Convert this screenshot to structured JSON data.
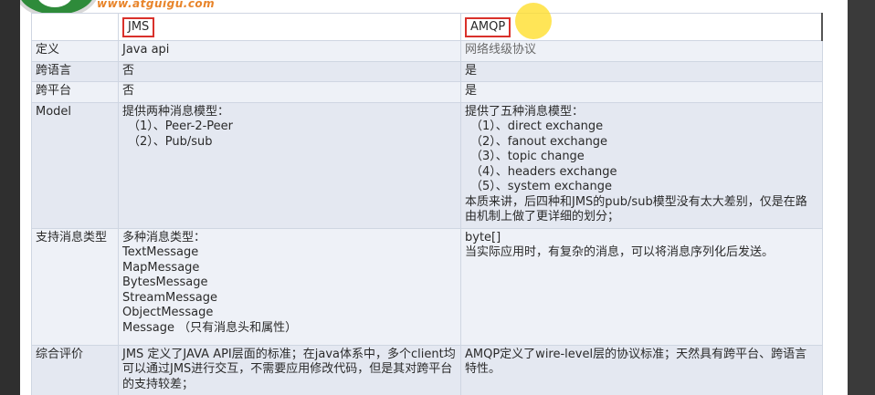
{
  "logo": {
    "text": "www.atguigu.com"
  },
  "table": {
    "header": {
      "left": "",
      "jms": "JMS",
      "amqp": "AMQP"
    },
    "rows": [
      {
        "label": "定义",
        "jms": [
          "Java api"
        ],
        "amqp": [
          "网络线级协议"
        ]
      },
      {
        "label": "跨语言",
        "jms": [
          "否"
        ],
        "amqp": [
          "是"
        ]
      },
      {
        "label": "跨平台",
        "jms": [
          "否"
        ],
        "amqp": [
          "是"
        ]
      },
      {
        "label": "Model",
        "jms": [
          "提供两种消息模型：",
          "（1）、Peer-2-Peer",
          "（2）、Pub/sub"
        ],
        "amqp": [
          "提供了五种消息模型：",
          "（1）、direct exchange",
          "（2）、fanout exchange",
          "（3）、topic change",
          "（4）、headers exchange",
          "（5）、system exchange",
          "本质来讲，后四种和JMS的pub/sub模型没有太大差别，仅是在路由机制上做了更详细的划分；"
        ]
      },
      {
        "label": "支持消息类型",
        "jms": [
          "多种消息类型：",
          "TextMessage",
          "MapMessage",
          "BytesMessage",
          "StreamMessage",
          "ObjectMessage",
          "Message （只有消息头和属性）"
        ],
        "amqp": [
          "byte[]",
          "当实际应用时，有复杂的消息，可以将消息序列化后发送。"
        ]
      },
      {
        "label": "综合评价",
        "jms": [
          "JMS 定义了JAVA API层面的标准；在java体系中，多个client均可以通过JMS进行交互，不需要应用修改代码，但是其对跨平台的支持较差；"
        ],
        "amqp": [
          "AMQP定义了wire-level层的协议标准；天然具有跨平台、跨语言特性。"
        ]
      }
    ]
  },
  "colors": {
    "highlight_box": "#d9312b",
    "cursor_highlight": "#ffde28",
    "logo_green": "#2e8b3a",
    "logo_text": "#e8842a"
  }
}
